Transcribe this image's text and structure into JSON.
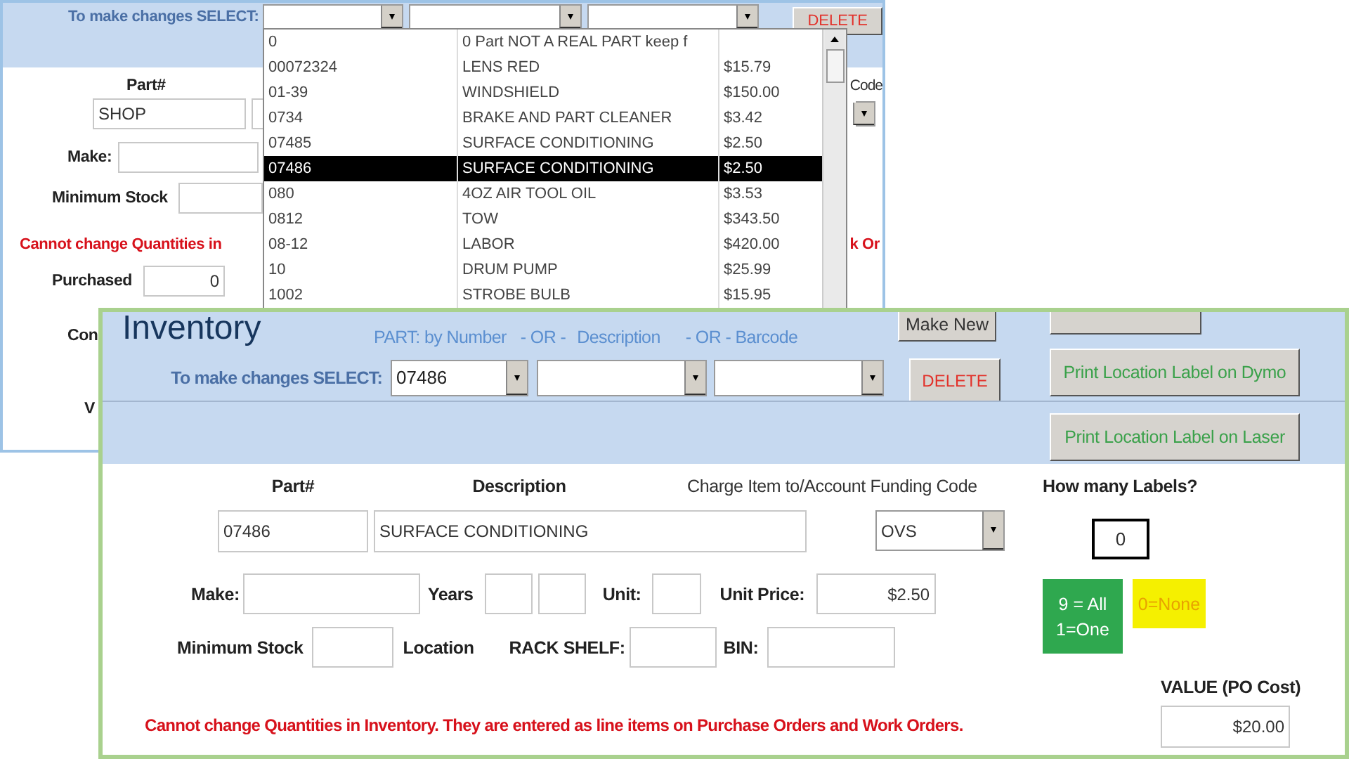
{
  "back_window": {
    "select_label": "To make changes SELECT:",
    "delete_button": "DELETE",
    "part_label": "Part#",
    "code_label": "Code",
    "part_value": "SHOP",
    "make_label": "Make:",
    "minimum_stock_label": "Minimum Stock",
    "warning": "Cannot change Quantities in",
    "warning_tail": "k Or",
    "purchased_label": "Purchased",
    "purchased_value": "0",
    "label_con": "Con",
    "label_v": "V"
  },
  "dropdown": {
    "rows": [
      {
        "part": "0",
        "description": "0 Part NOT A REAL PART keep f",
        "selected": false
      },
      {
        "part": "00072324",
        "description": "LENS RED",
        "price": "$15.79",
        "selected": false
      },
      {
        "part": "01-39",
        "description": "WINDSHIELD",
        "price": "$150.00",
        "selected": false
      },
      {
        "part": "0734",
        "description": "BRAKE AND PART CLEANER",
        "price": "$3.42",
        "selected": false
      },
      {
        "part": "07485",
        "description": "SURFACE CONDITIONING",
        "price": "$2.50",
        "selected": false
      },
      {
        "part": "07486",
        "description": "SURFACE CONDITIONING",
        "price": "$2.50",
        "selected": true
      },
      {
        "part": "080",
        "description": "4OZ AIR TOOL OIL",
        "price": "$3.53",
        "selected": false
      },
      {
        "part": "0812",
        "description": "TOW",
        "price": "$343.50",
        "selected": false
      },
      {
        "part": "08-12",
        "description": "LABOR",
        "price": "$420.00",
        "selected": false
      },
      {
        "part": "10",
        "description": "DRUM PUMP",
        "price": "$25.99",
        "selected": false
      },
      {
        "part": "1002",
        "description": "STROBE BULB",
        "price": "$15.95",
        "selected": false
      }
    ]
  },
  "front_window": {
    "title": "Inventory",
    "search_hints": [
      "PART: by Number",
      "- OR -",
      "Description",
      "- OR - Barcode"
    ],
    "select_label": "To make changes SELECT:",
    "select_value": "07486",
    "make_new_button": "Make New",
    "delete_button": "DELETE",
    "print_buttons": [
      "Print Location Label on Dymo",
      "Print Location Label on Laser"
    ],
    "part_label": "Part#",
    "description_label": "Description",
    "charge_label": "Charge Item to/Account Funding Code",
    "part_value": "07486",
    "description_value": "SURFACE CONDITIONING",
    "funding_code": "OVS",
    "make_label": "Make:",
    "years_label": "Years",
    "unit_label": "Unit:",
    "unit_price_label": "Unit Price:",
    "unit_price_value": "$2.50",
    "minimum_stock_label": "Minimum Stock",
    "location_label": "Location",
    "rack_shelf_label": "RACK SHELF:",
    "bin_label": "BIN:",
    "warning": "Cannot change Quantities in Inventory.  They are entered as line items on Purchase Orders and Work Orders.",
    "labels_label": "How many Labels?",
    "labels_value": "0",
    "labels_hint_all": "9 = All",
    "labels_hint_one": "1=One",
    "labels_hint_none": "0=None",
    "value_label": "VALUE (PO Cost)",
    "value_amount": "$20.00"
  }
}
